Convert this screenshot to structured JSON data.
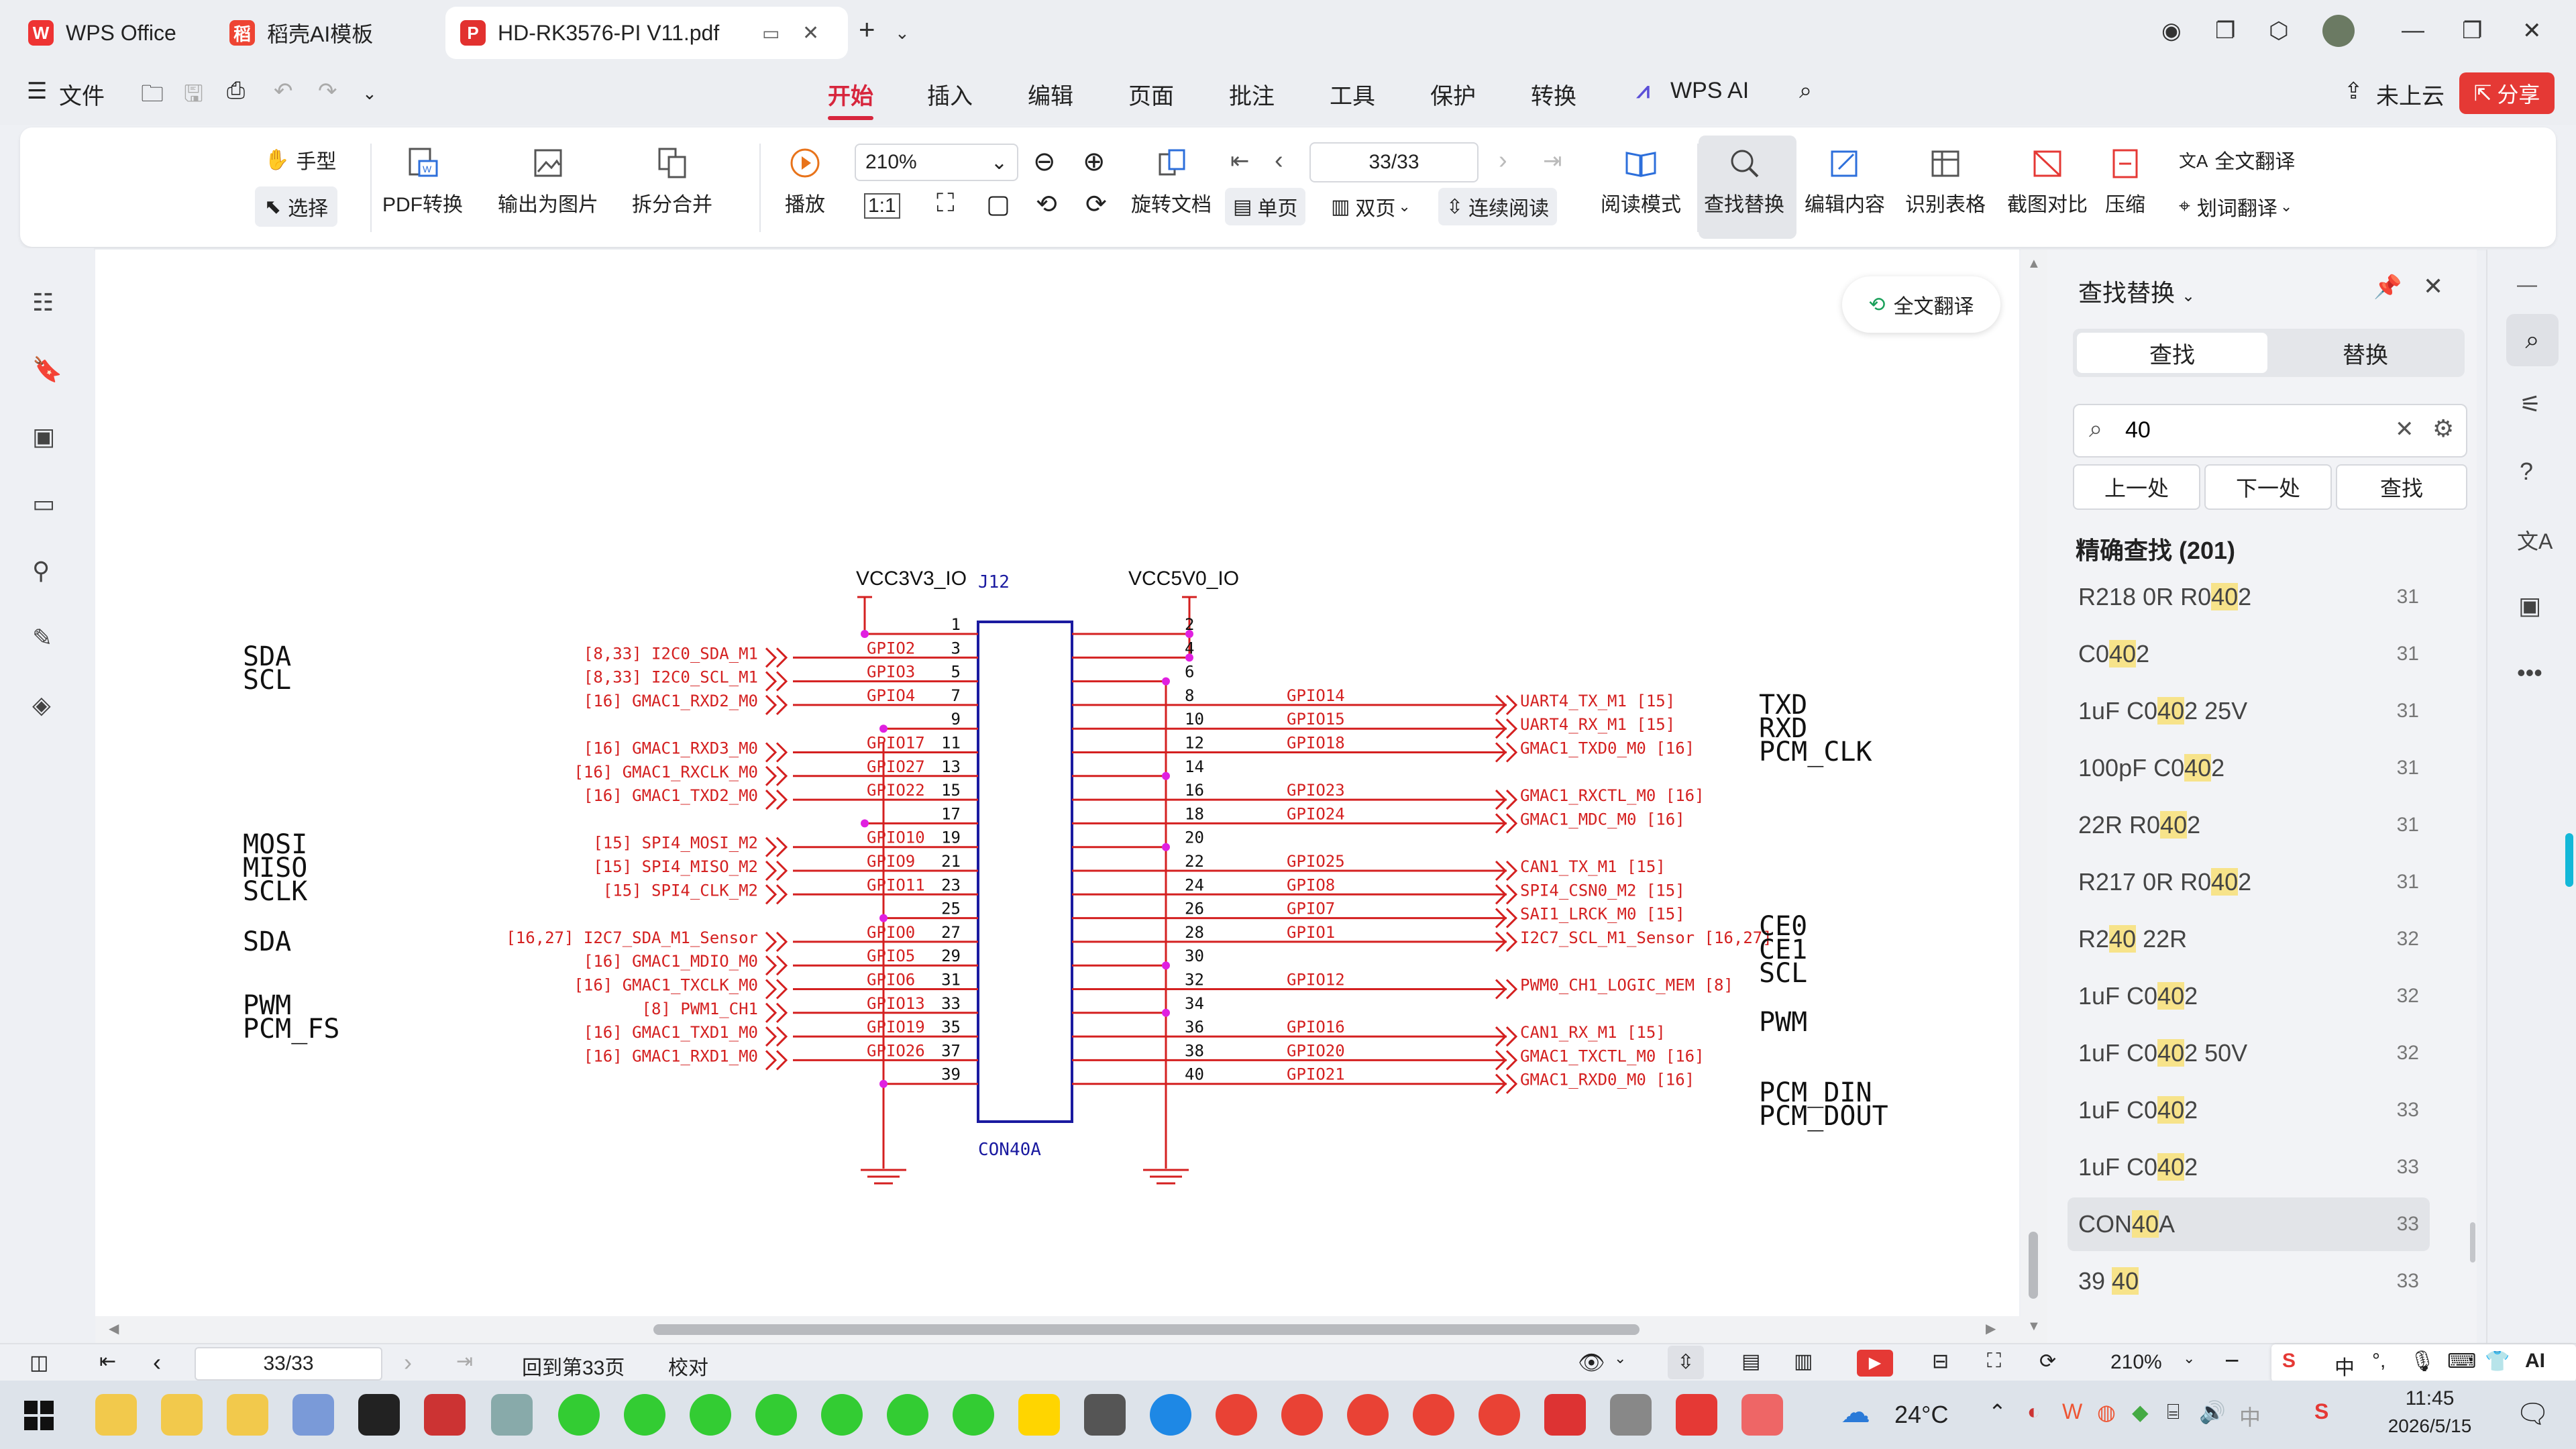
{
  "tabs": [
    {
      "label": "WPS Office"
    },
    {
      "label": "稻壳AI模板"
    },
    {
      "label": "HD-RK3576-PI V11.pdf"
    }
  ],
  "menu": {
    "file": "文件",
    "items": [
      "开始",
      "插入",
      "编辑",
      "页面",
      "批注",
      "工具",
      "保护",
      "转换"
    ],
    "wps_ai": "WPS AI",
    "upload": "未上云",
    "share": "分享"
  },
  "ribbon": {
    "hand": "手型",
    "select": "选择",
    "pdf_convert": "PDF转换",
    "export_image": "输出为图片",
    "split_merge": "拆分合并",
    "play": "播放",
    "zoom": "210%",
    "page": "33/33",
    "rotate": "旋转文档",
    "single": "单页",
    "double": "双页",
    "continuous": "连续阅读",
    "reading": "阅读模式",
    "find_replace": "查找替换",
    "edit_content": "编辑内容",
    "recognize_table": "识别表格",
    "screenshot_compare": "截图对比",
    "compress": "压缩",
    "full_translate": "全文翻译",
    "word_translate": "划词翻译"
  },
  "floating_translate": "全文翻译",
  "schematic": {
    "ref": "J12",
    "part": "CON40A",
    "vcc3": "VCC3V3_IO",
    "vcc5": "VCC5V0_IO",
    "left_aliases": [
      "SDA",
      "SCL",
      "MOSI",
      "MISO",
      "SCLK",
      "SDA",
      "PWM",
      "PCM_FS"
    ],
    "right_aliases": [
      "TXD",
      "RXD",
      "PCM_CLK",
      "CE0",
      "CE1",
      "SCL",
      "PWM",
      "PCM_DIN",
      "PCM_DOUT"
    ],
    "left_pins": [
      {
        "pin": "1",
        "gpio": "",
        "net": ""
      },
      {
        "pin": "3",
        "gpio": "GPIO2",
        "net": "[8,33] I2C0_SDA_M1"
      },
      {
        "pin": "5",
        "gpio": "GPIO3",
        "net": "[8,33] I2C0_SCL_M1"
      },
      {
        "pin": "7",
        "gpio": "GPIO4",
        "net": "[16] GMAC1_RXD2_M0"
      },
      {
        "pin": "9",
        "gpio": "",
        "net": ""
      },
      {
        "pin": "11",
        "gpio": "GPIO17",
        "net": "[16] GMAC1_RXD3_M0"
      },
      {
        "pin": "13",
        "gpio": "GPIO27",
        "net": "[16] GMAC1_RXCLK_M0"
      },
      {
        "pin": "15",
        "gpio": "GPIO22",
        "net": "[16] GMAC1_TXD2_M0"
      },
      {
        "pin": "17",
        "gpio": "",
        "net": ""
      },
      {
        "pin": "19",
        "gpio": "GPIO10",
        "net": "[15] SPI4_MOSI_M2"
      },
      {
        "pin": "21",
        "gpio": "GPIO9",
        "net": "[15] SPI4_MISO_M2"
      },
      {
        "pin": "23",
        "gpio": "GPIO11",
        "net": "[15] SPI4_CLK_M2"
      },
      {
        "pin": "25",
        "gpio": "",
        "net": ""
      },
      {
        "pin": "27",
        "gpio": "GPIO0",
        "net": "[16,27] I2C7_SDA_M1_Sensor"
      },
      {
        "pin": "29",
        "gpio": "GPIO5",
        "net": "[16] GMAC1_MDIO_M0"
      },
      {
        "pin": "31",
        "gpio": "GPIO6",
        "net": "[16] GMAC1_TXCLK_M0"
      },
      {
        "pin": "33",
        "gpio": "GPIO13",
        "net": "[8] PWM1_CH1"
      },
      {
        "pin": "35",
        "gpio": "GPIO19",
        "net": "[16] GMAC1_TXD1_M0"
      },
      {
        "pin": "37",
        "gpio": "GPIO26",
        "net": "[16] GMAC1_RXD1_M0"
      },
      {
        "pin": "39",
        "gpio": "",
        "net": ""
      }
    ],
    "right_pins": [
      {
        "pin": "2",
        "gpio": "",
        "net": ""
      },
      {
        "pin": "4",
        "gpio": "",
        "net": ""
      },
      {
        "pin": "6",
        "gpio": "",
        "net": ""
      },
      {
        "pin": "8",
        "gpio": "GPIO14",
        "net": "UART4_TX_M1 [15]"
      },
      {
        "pin": "10",
        "gpio": "GPIO15",
        "net": "UART4_RX_M1 [15]"
      },
      {
        "pin": "12",
        "gpio": "GPIO18",
        "net": "GMAC1_TXD0_M0 [16]"
      },
      {
        "pin": "14",
        "gpio": "",
        "net": ""
      },
      {
        "pin": "16",
        "gpio": "GPIO23",
        "net": "GMAC1_RXCTL_M0 [16]"
      },
      {
        "pin": "18",
        "gpio": "GPIO24",
        "net": "GMAC1_MDC_M0 [16]"
      },
      {
        "pin": "20",
        "gpio": "",
        "net": ""
      },
      {
        "pin": "22",
        "gpio": "GPIO25",
        "net": "CAN1_TX_M1 [15]"
      },
      {
        "pin": "24",
        "gpio": "GPIO8",
        "net": "SPI4_CSN0_M2 [15]"
      },
      {
        "pin": "26",
        "gpio": "GPIO7",
        "net": "SAI1_LRCK_M0 [15]"
      },
      {
        "pin": "28",
        "gpio": "GPIO1",
        "net": "I2C7_SCL_M1_Sensor [16,27]"
      },
      {
        "pin": "30",
        "gpio": "",
        "net": ""
      },
      {
        "pin": "32",
        "gpio": "GPIO12",
        "net": "PWM0_CH1_LOGIC_MEM [8]"
      },
      {
        "pin": "34",
        "gpio": "",
        "net": ""
      },
      {
        "pin": "36",
        "gpio": "GPIO16",
        "net": "CAN1_RX_M1 [15]"
      },
      {
        "pin": "38",
        "gpio": "GPIO20",
        "net": "GMAC1_TXCTL_M0 [16]"
      },
      {
        "pin": "40",
        "gpio": "GPIO21",
        "net": "GMAC1_RXD0_M0 [16]"
      }
    ]
  },
  "panel": {
    "title": "查找替换",
    "tab_find": "查找",
    "tab_replace": "替换",
    "search_value": "40",
    "prev": "上一处",
    "next": "下一处",
    "find": "查找",
    "result_header": "精确查找 (201)",
    "results": [
      {
        "text": "R218 0R R0402",
        "page": "31"
      },
      {
        "text": "C0402",
        "page": "31"
      },
      {
        "text": "1uF C0402 25V",
        "page": "31"
      },
      {
        "text": "100pF C0402",
        "page": "31"
      },
      {
        "text": "22R R0402",
        "page": "31"
      },
      {
        "text": "R217 0R R0402",
        "page": "31"
      },
      {
        "text": "R240 22R",
        "page": "32"
      },
      {
        "text": "1uF C0402",
        "page": "32"
      },
      {
        "text": "1uF C0402 50V",
        "page": "32"
      },
      {
        "text": "1uF C0402",
        "page": "33"
      },
      {
        "text": "1uF C0402",
        "page": "33"
      },
      {
        "text": "CON40A",
        "page": "33"
      },
      {
        "text": "39 40",
        "page": "33"
      }
    ]
  },
  "status": {
    "page": "33/33",
    "goto": "回到第33页",
    "proofread": "校对",
    "zoom": "210%"
  },
  "taskbar": {
    "weather": "24°C",
    "time": "11:45",
    "date": "2026/5/15",
    "ime": "中"
  }
}
